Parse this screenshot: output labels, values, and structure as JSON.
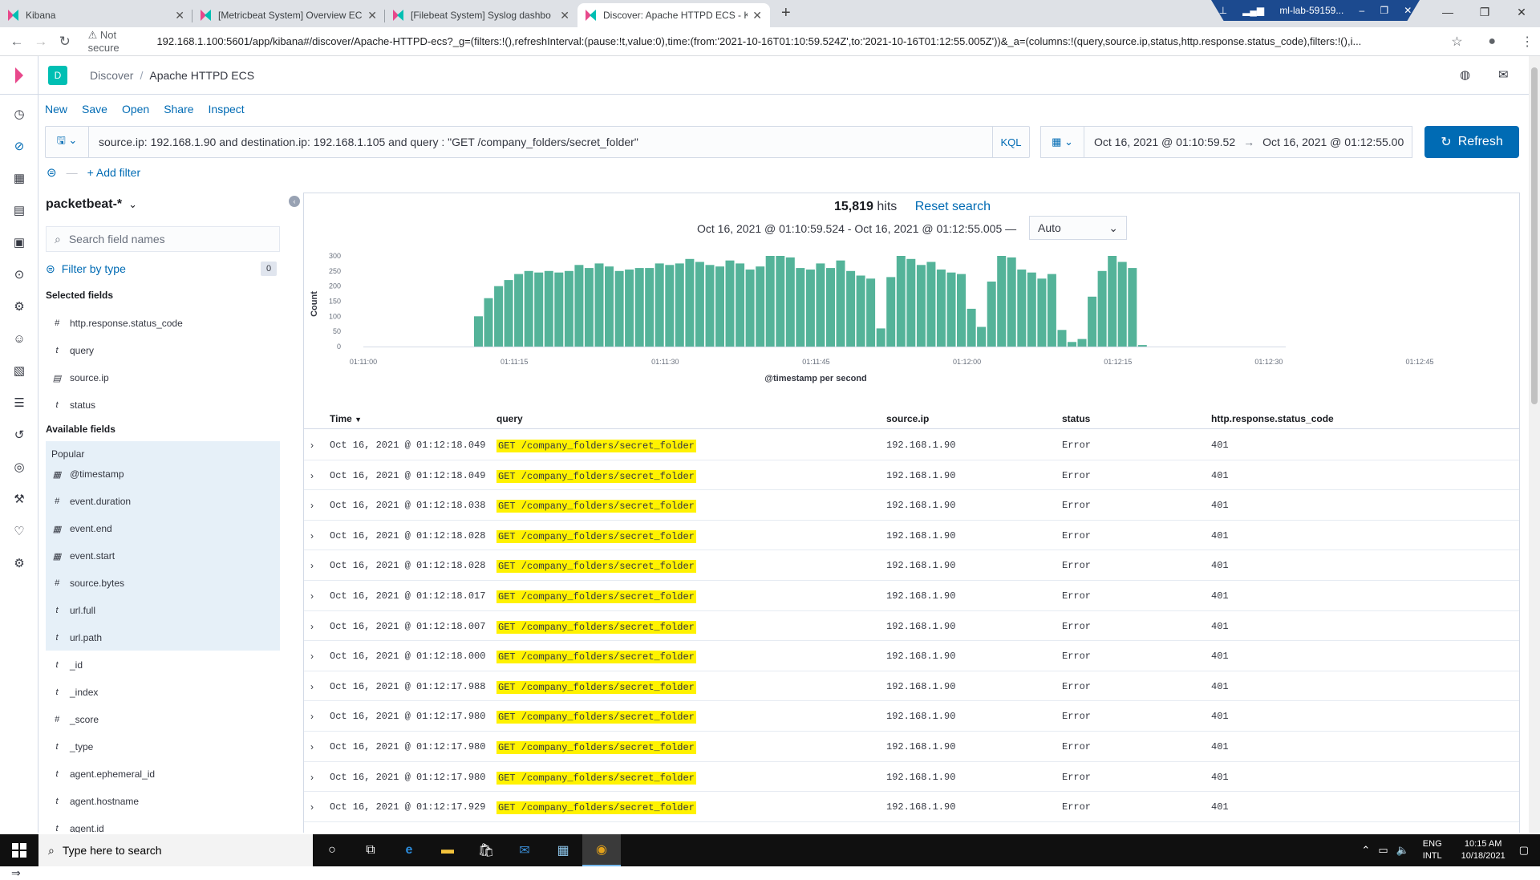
{
  "browser": {
    "tabs": [
      {
        "title": "Kibana"
      },
      {
        "title": "[Metricbeat System] Overview EC"
      },
      {
        "title": "[Filebeat System] Syslog dashbo"
      },
      {
        "title": "Discover: Apache HTTPD ECS - K"
      }
    ],
    "rdp_title": "ml-lab-59159...",
    "security": "Not secure",
    "url": "192.168.1.100:5601/app/kibana#/discover/Apache-HTTPD-ecs?_g=(filters:!(),refreshInterval:(pause:!t,value:0),time:(from:'2021-10-16T01:10:59.524Z',to:'2021-10-16T01:12:55.005Z'))&_a=(columns:!(query,source.ip,status,http.response.status_code),filters:!(),i..."
  },
  "kibana": {
    "space_initial": "D",
    "breadcrumb": {
      "root": "Discover",
      "current": "Apache HTTPD ECS"
    },
    "topnav": [
      "New",
      "Save",
      "Open",
      "Share",
      "Inspect"
    ],
    "query": "source.ip: 192.168.1.90 and destination.ip: 192.168.1.105 and query : \"GET /company_folders/secret_folder\"",
    "query_language": "KQL",
    "date_from": "Oct 16, 2021 @ 01:10:59.52",
    "date_to": "Oct 16, 2021 @ 01:12:55.00",
    "refresh_label": "Refresh",
    "add_filter": "+ Add filter"
  },
  "sidebar": {
    "index_pattern": "packetbeat-*",
    "search_placeholder": "Search field names",
    "filter_by_type": "Filter by type",
    "filter_count": "0",
    "selected_header": "Selected fields",
    "selected_fields": [
      {
        "type": "#",
        "name": "http.response.status_code"
      },
      {
        "type": "t",
        "name": "query"
      },
      {
        "type": "ip",
        "name": "source.ip"
      },
      {
        "type": "t",
        "name": "status"
      }
    ],
    "available_header": "Available fields",
    "popular_label": "Popular",
    "popular_fields": [
      {
        "type": "cal",
        "name": "@timestamp"
      },
      {
        "type": "#",
        "name": "event.duration"
      },
      {
        "type": "cal",
        "name": "event.end"
      },
      {
        "type": "cal",
        "name": "event.start"
      },
      {
        "type": "#",
        "name": "source.bytes"
      },
      {
        "type": "t",
        "name": "url.full"
      },
      {
        "type": "t",
        "name": "url.path"
      }
    ],
    "other_fields": [
      {
        "type": "t",
        "name": "_id"
      },
      {
        "type": "t",
        "name": "_index"
      },
      {
        "type": "#",
        "name": "_score"
      },
      {
        "type": "t",
        "name": "_type"
      },
      {
        "type": "t",
        "name": "agent.ephemeral_id"
      },
      {
        "type": "t",
        "name": "agent.hostname"
      },
      {
        "type": "t",
        "name": "agent.id"
      }
    ]
  },
  "results": {
    "hits": "15,819",
    "hits_label": "hits",
    "reset": "Reset search",
    "range": "Oct 16, 2021 @ 01:10:59.524 - Oct 16, 2021 @ 01:12:55.005 —",
    "interval": "Auto",
    "columns": [
      "Time",
      "query",
      "source.ip",
      "status",
      "http.response.status_code"
    ],
    "rows": [
      {
        "time": "Oct 16, 2021 @ 01:12:18.049",
        "query": "GET /company_folders/secret_folder",
        "ip": "192.168.1.90",
        "status": "Error",
        "code": "401"
      },
      {
        "time": "Oct 16, 2021 @ 01:12:18.049",
        "query": "GET /company_folders/secret_folder",
        "ip": "192.168.1.90",
        "status": "Error",
        "code": "401"
      },
      {
        "time": "Oct 16, 2021 @ 01:12:18.038",
        "query": "GET /company_folders/secret_folder",
        "ip": "192.168.1.90",
        "status": "Error",
        "code": "401"
      },
      {
        "time": "Oct 16, 2021 @ 01:12:18.028",
        "query": "GET /company_folders/secret_folder",
        "ip": "192.168.1.90",
        "status": "Error",
        "code": "401"
      },
      {
        "time": "Oct 16, 2021 @ 01:12:18.028",
        "query": "GET /company_folders/secret_folder",
        "ip": "192.168.1.90",
        "status": "Error",
        "code": "401"
      },
      {
        "time": "Oct 16, 2021 @ 01:12:18.017",
        "query": "GET /company_folders/secret_folder",
        "ip": "192.168.1.90",
        "status": "Error",
        "code": "401"
      },
      {
        "time": "Oct 16, 2021 @ 01:12:18.007",
        "query": "GET /company_folders/secret_folder",
        "ip": "192.168.1.90",
        "status": "Error",
        "code": "401"
      },
      {
        "time": "Oct 16, 2021 @ 01:12:18.000",
        "query": "GET /company_folders/secret_folder",
        "ip": "192.168.1.90",
        "status": "Error",
        "code": "401"
      },
      {
        "time": "Oct 16, 2021 @ 01:12:17.988",
        "query": "GET /company_folders/secret_folder",
        "ip": "192.168.1.90",
        "status": "Error",
        "code": "401"
      },
      {
        "time": "Oct 16, 2021 @ 01:12:17.980",
        "query": "GET /company_folders/secret_folder",
        "ip": "192.168.1.90",
        "status": "Error",
        "code": "401"
      },
      {
        "time": "Oct 16, 2021 @ 01:12:17.980",
        "query": "GET /company_folders/secret_folder",
        "ip": "192.168.1.90",
        "status": "Error",
        "code": "401"
      },
      {
        "time": "Oct 16, 2021 @ 01:12:17.980",
        "query": "GET /company_folders/secret_folder",
        "ip": "192.168.1.90",
        "status": "Error",
        "code": "401"
      },
      {
        "time": "Oct 16, 2021 @ 01:12:17.929",
        "query": "GET /company_folders/secret_folder",
        "ip": "192.168.1.90",
        "status": "Error",
        "code": "401"
      }
    ]
  },
  "chart_data": {
    "type": "bar",
    "xlabel": "@timestamp per second",
    "ylabel": "Count",
    "ylim": [
      0,
      300
    ],
    "yticks": [
      0,
      50,
      100,
      150,
      200,
      250,
      300
    ],
    "xticks": [
      "01:11:00",
      "01:11:15",
      "01:11:30",
      "01:11:45",
      "01:12:00",
      "01:12:15",
      "01:12:30",
      "01:12:45"
    ],
    "x_start_second": 0,
    "bar_color": "#54b399",
    "values": [
      0,
      0,
      0,
      0,
      0,
      0,
      0,
      0,
      0,
      0,
      0,
      100,
      160,
      200,
      220,
      240,
      250,
      245,
      250,
      245,
      250,
      270,
      260,
      275,
      265,
      250,
      255,
      260,
      260,
      275,
      270,
      275,
      290,
      280,
      270,
      265,
      285,
      275,
      255,
      265,
      300,
      300,
      295,
      260,
      255,
      275,
      260,
      285,
      250,
      235,
      225,
      60,
      230,
      300,
      290,
      270,
      280,
      255,
      245,
      240,
      125,
      65,
      215,
      300,
      295,
      255,
      245,
      225,
      240,
      55,
      15,
      25,
      165,
      250,
      300,
      280,
      260,
      5
    ],
    "grid": false
  },
  "taskbar": {
    "search": "Type here to search",
    "lang": "ENG",
    "layout": "INTL",
    "time": "10:15 AM",
    "date": "10/18/2021"
  }
}
